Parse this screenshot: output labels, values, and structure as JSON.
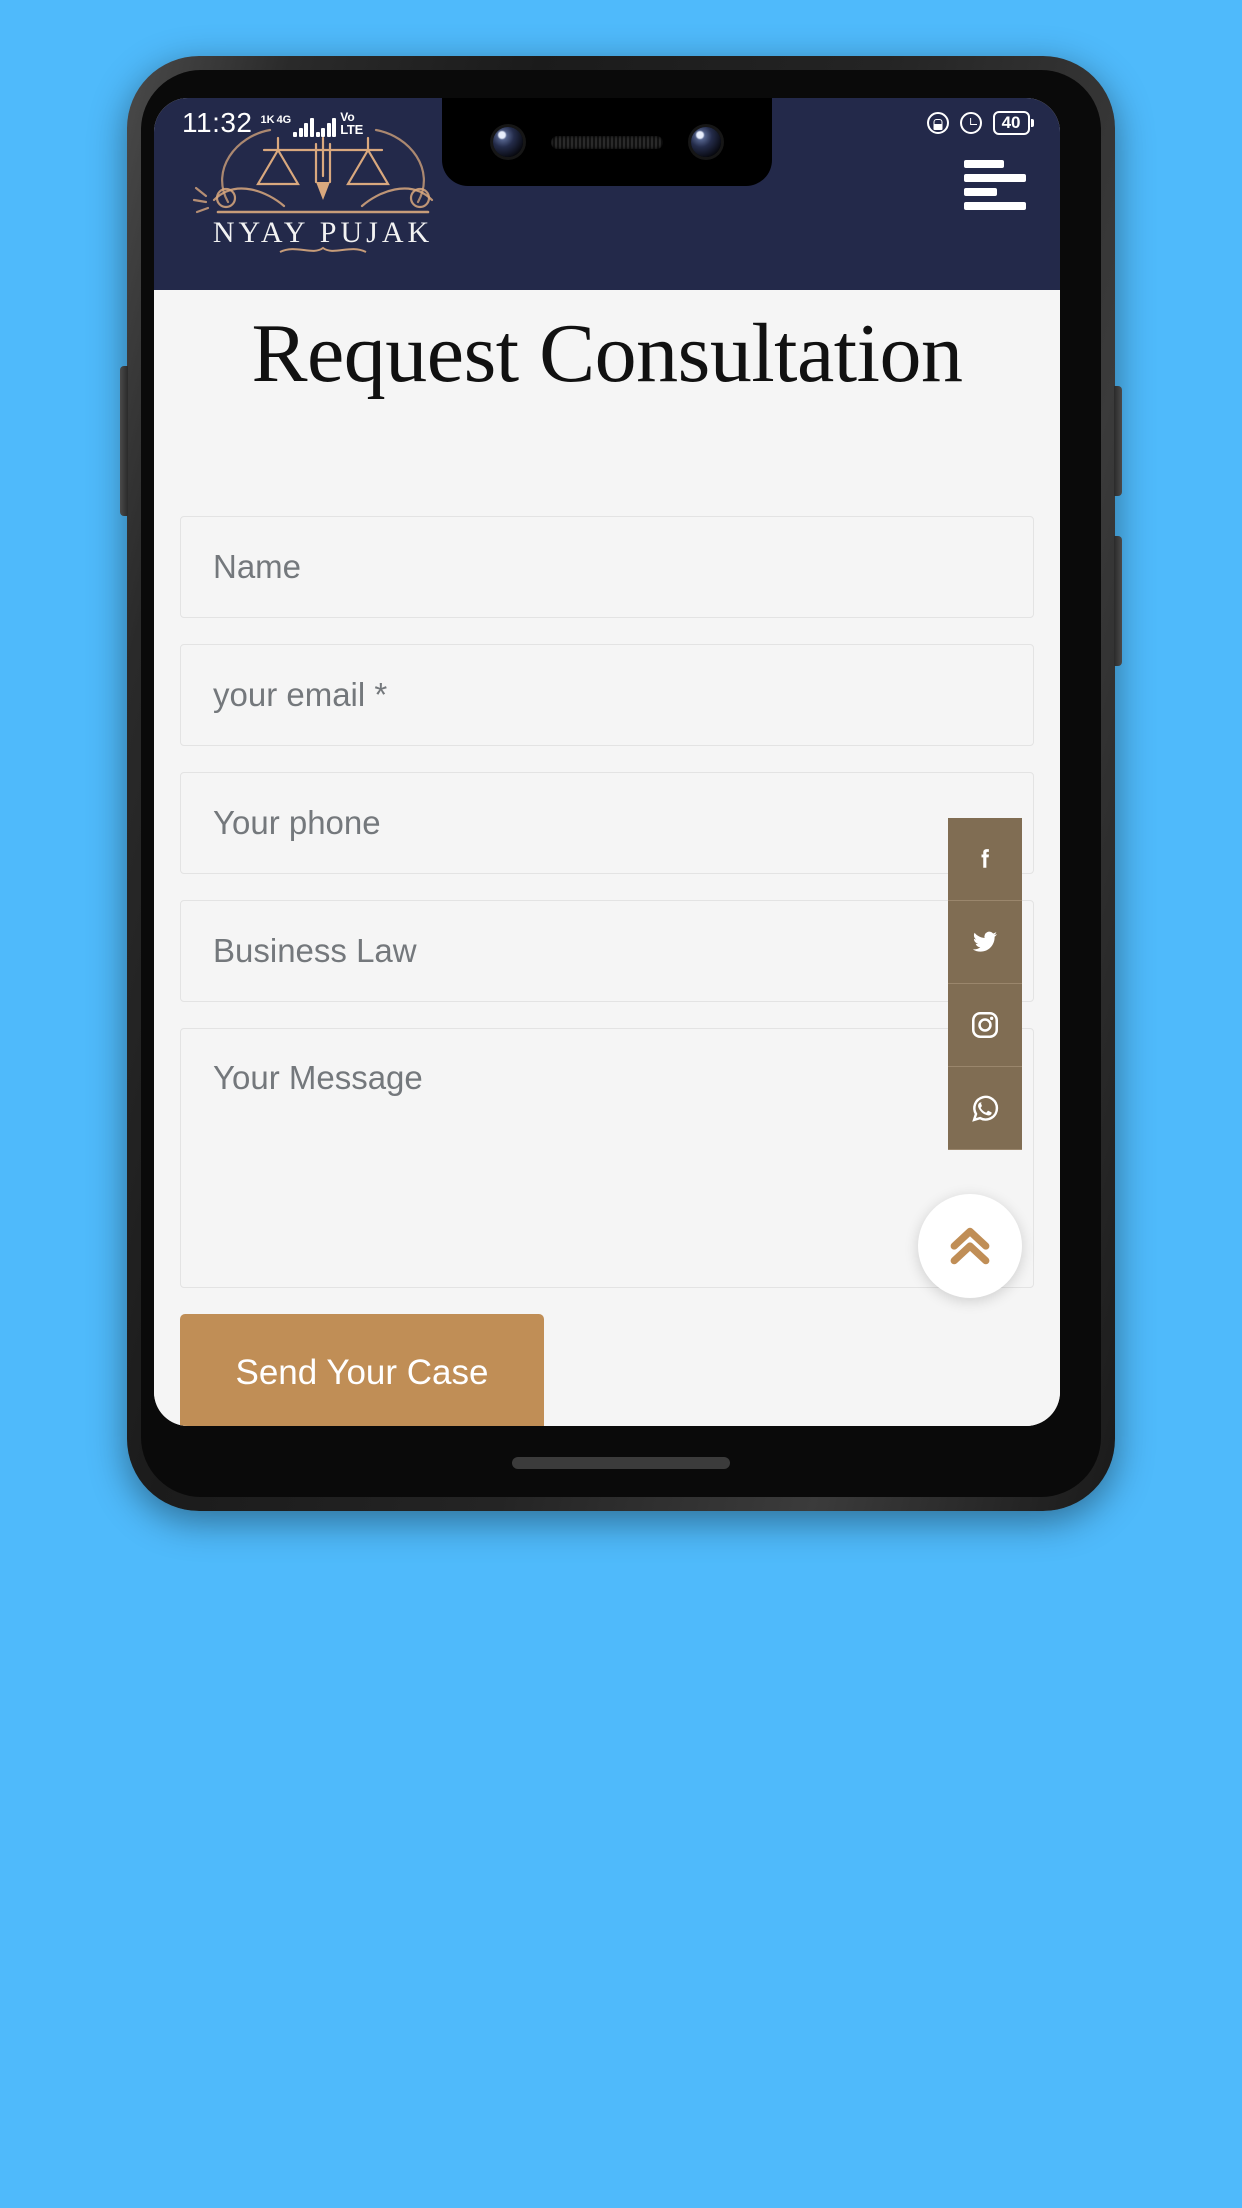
{
  "device": {
    "status_bar": {
      "time": "11:32",
      "network_speed": "1K",
      "network_type": "4G",
      "volte_top": "Vo",
      "volte_bottom": "LTE",
      "sim_badge": "1",
      "rotation_lock_icon": "rotation-lock-icon",
      "alarm_icon": "alarm-clock-icon",
      "battery_percent": "40"
    },
    "notch": {
      "front_camera_icon": "front-camera-icon",
      "earpiece_icon": "earpiece-speaker-icon",
      "secondary_camera_icon": "secondary-camera-icon"
    },
    "home_indicator": "home-indicator-bar"
  },
  "header": {
    "brand_name": "NYAY PUJAK",
    "brand_logo_icon": "scales-of-justice-logo",
    "menu_icon": "hamburger-menu-icon",
    "background_color": "#23294a"
  },
  "main": {
    "title": "Request Consultation",
    "form": {
      "fields": [
        {
          "name": "name",
          "placeholder": "Name",
          "value": "",
          "type": "text"
        },
        {
          "name": "email",
          "placeholder": "your email *",
          "value": "",
          "type": "email"
        },
        {
          "name": "phone",
          "placeholder": "Your phone",
          "value": "",
          "type": "tel"
        },
        {
          "name": "message",
          "placeholder": "Your Message",
          "value": "",
          "type": "textarea"
        }
      ],
      "practice_area_select": {
        "selected": "Business Law",
        "chevron_icon": "chevron-down-icon"
      },
      "submit_label": "Send Your Case",
      "submit_color": "#c08e56"
    }
  },
  "social_rail": {
    "background_color": "#806d53",
    "items": [
      {
        "name": "facebook",
        "icon": "facebook-icon"
      },
      {
        "name": "twitter",
        "icon": "twitter-icon"
      },
      {
        "name": "instagram",
        "icon": "instagram-icon"
      },
      {
        "name": "whatsapp",
        "icon": "whatsapp-icon"
      }
    ]
  },
  "scroll_top": {
    "icon": "double-chevron-up-icon",
    "accent_color": "#c08e56"
  },
  "backdrop": {
    "color": "#4FBAFB"
  }
}
